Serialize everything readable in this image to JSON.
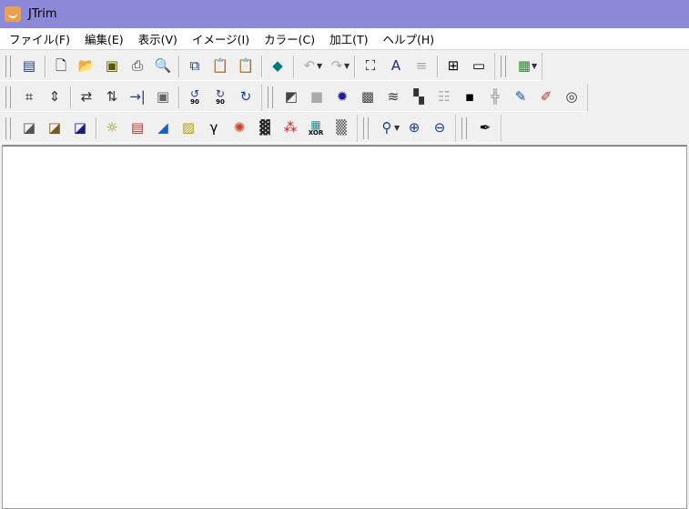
{
  "window": {
    "title": "JTrim"
  },
  "menu": [
    "ファイル(F)",
    "編集(E)",
    "表示(V)",
    "イメージ(I)",
    "カラー(C)",
    "加工(T)",
    "ヘルプ(H)"
  ],
  "toolbars": [
    [
      [
        "window-icon",
        "|",
        "new-file-icon",
        "open-folder-icon",
        "save-icon",
        "print-icon",
        "print-preview-icon",
        "|",
        "copy-icon",
        "paste-icon",
        "paste-new-icon",
        "|",
        "fill-icon",
        "|",
        "undo-icon",
        "dd",
        "redo-icon",
        "dd",
        "|",
        "fit-window-icon",
        "text-icon",
        "lines-icon",
        "|",
        "grid-view-icon",
        "filmstrip-icon"
      ],
      [
        "palette-icon",
        "dd"
      ]
    ],
    [
      [
        "crop-icon",
        "resize-icon",
        "|",
        "flip-horizontal-icon",
        "flip-vertical-icon",
        "mirror-icon",
        "frame-icon",
        "|",
        "rotate-left-90-icon",
        "rotate-right-90-icon",
        "rotate-free-icon"
      ],
      [
        "shadow-icon",
        "button-effect-icon",
        "blur-icon",
        "mosaic-icon",
        "wave-icon",
        "tile-icon",
        "brick-icon",
        "emboss-icon",
        "edge-icon",
        "pen-icon",
        "marker-icon",
        "spiral-icon"
      ]
    ],
    [
      [
        "grayscale-icon",
        "sepia-icon",
        "negative-icon",
        "|",
        "brightness-icon",
        "color-balance-icon",
        "tone-curve-icon",
        "picture-icon",
        "gamma-icon",
        "hue-icon",
        "dither-icon",
        "rgb-icon",
        "xor-icon",
        "gradient-icon"
      ],
      [
        "zoom-icon",
        "dd",
        "zoom-in-icon",
        "zoom-out-icon"
      ],
      [
        "eyedropper-icon"
      ]
    ]
  ],
  "labels": {
    "xor": "XOR",
    "rot90": "90"
  }
}
